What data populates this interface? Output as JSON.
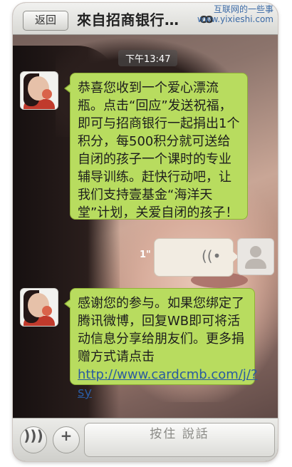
{
  "header": {
    "back_label": "返回",
    "title": "來自招商银行…",
    "watermark_line1": "互联网的一些事",
    "watermark_line2": "www.yixieshi.com"
  },
  "timestamp": "下午13:47",
  "messages": [
    {
      "sender": "incoming",
      "text": "恭喜您收到一个爱心漂流瓶。点击“回应”发送祝福，即可与招商银行一起捐出1个积分，每500积分就可送给自闭的孩子一个课时的专业辅导训练。赶快行动吧，让我们支持壹基金“海洋天堂”计划，关爱自闭的孩子！"
    },
    {
      "sender": "outgoing-voice",
      "duration": "1\""
    },
    {
      "sender": "incoming",
      "text": "感谢您的参与。如果您绑定了腾讯微博，回复WB即可将活动信息分享给朋友们。更多捐赠方式请点击",
      "link": "http://www.cardcmb.com/j/?sy"
    }
  ],
  "footer": {
    "voice_icon": "voice-icon",
    "plus_icon": "plus-icon",
    "hold_to_talk": "按住 說話"
  },
  "colors": {
    "bubble_green": "#b8dc5f",
    "link_blue": "#2a5aa0"
  }
}
